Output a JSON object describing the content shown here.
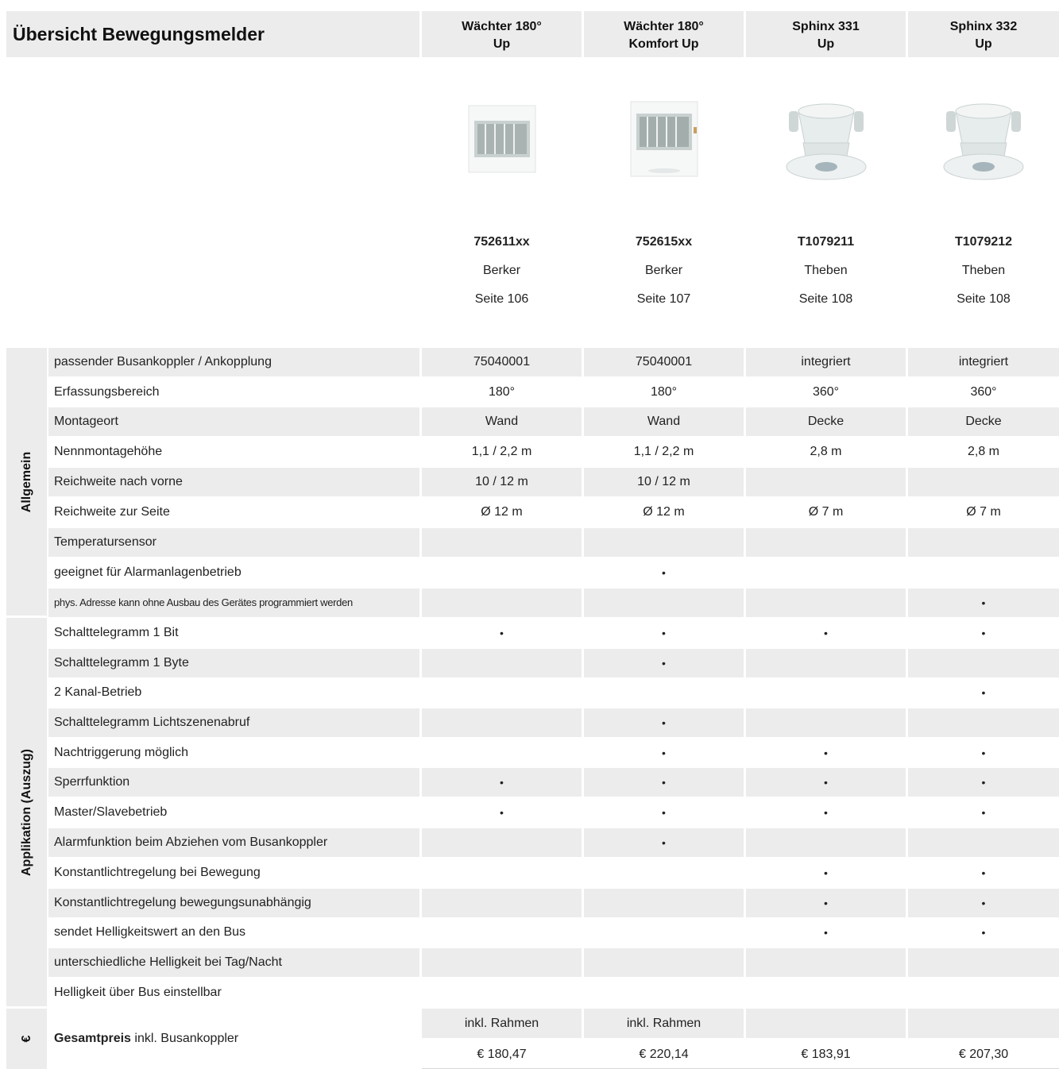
{
  "title": "Übersicht Bewegungsmelder",
  "products": [
    {
      "name1": "Wächter 180°",
      "name2": "Up",
      "number": "752611xx",
      "brand": "Berker",
      "page": "Seite 106",
      "image": "waechter-device-image",
      "extra": "inkl. Rahmen",
      "price": "€ 180,47"
    },
    {
      "name1": "Wächter 180°",
      "name2": "Komfort Up",
      "number": "752615xx",
      "brand": "Berker",
      "page": "Seite 107",
      "image": "waechter-komfort-device-image",
      "extra": "inkl. Rahmen",
      "price": "€ 220,14"
    },
    {
      "name1": "Sphinx 331",
      "name2": "Up",
      "number": "T1079211",
      "brand": "Theben",
      "page": "Seite 108",
      "image": "sphinx-device-image",
      "extra": "",
      "price": "€ 183,91"
    },
    {
      "name1": "Sphinx 332",
      "name2": "Up",
      "number": "T1079212",
      "brand": "Theben",
      "page": "Seite 108",
      "image": "sphinx-device-image",
      "extra": "",
      "price": "€ 207,30"
    }
  ],
  "sections": {
    "allgemein": "Allgemein",
    "applikation": "Applikation (Auszug)",
    "preis": "€"
  },
  "rows": [
    {
      "label": "passender Busankoppler / Ankopplung",
      "values": [
        "75040001",
        "75040001",
        "integriert",
        "integriert"
      ]
    },
    {
      "label": "Erfassungsbereich",
      "values": [
        "180°",
        "180°",
        "360°",
        "360°"
      ]
    },
    {
      "label": "Montageort",
      "values": [
        "Wand",
        "Wand",
        "Decke",
        "Decke"
      ]
    },
    {
      "label": "Nennmontagehöhe",
      "values": [
        "1,1 / 2,2 m",
        "1,1 / 2,2 m",
        "2,8 m",
        "2,8 m"
      ]
    },
    {
      "label": "Reichweite nach vorne",
      "values": [
        "10 / 12 m",
        "10 / 12 m",
        "",
        ""
      ]
    },
    {
      "label": "Reichweite zur Seite",
      "values": [
        "Ø 12 m",
        "Ø 12 m",
        "Ø 7 m",
        "Ø 7 m"
      ]
    },
    {
      "label": "Temperatursensor",
      "values": [
        "",
        "",
        "",
        ""
      ]
    },
    {
      "label": "geeignet für Alarmanlagenbetrieb",
      "values": [
        "",
        "•",
        "",
        ""
      ]
    },
    {
      "label": "phys. Adresse kann ohne Ausbau des Gerätes programmiert werden",
      "values": [
        "",
        "",
        "",
        "•"
      ]
    },
    {
      "label": "Schalttelegramm 1 Bit",
      "values": [
        "•",
        "•",
        "•",
        "•"
      ]
    },
    {
      "label": "Schalttelegramm 1 Byte",
      "values": [
        "",
        "•",
        "",
        ""
      ]
    },
    {
      "label": "2 Kanal-Betrieb",
      "values": [
        "",
        "",
        "",
        "•"
      ]
    },
    {
      "label": "Schalttelegramm Lichtszenenabruf",
      "values": [
        "",
        "•",
        "",
        ""
      ]
    },
    {
      "label": "Nachtriggerung möglich",
      "values": [
        "",
        "•",
        "•",
        "•"
      ]
    },
    {
      "label": "Sperrfunktion",
      "values": [
        "•",
        "•",
        "•",
        "•"
      ]
    },
    {
      "label": "Master/Slavebetrieb",
      "values": [
        "•",
        "•",
        "•",
        "•"
      ]
    },
    {
      "label": "Alarmfunktion beim Abziehen vom Busankoppler",
      "values": [
        "",
        "•",
        "",
        ""
      ]
    },
    {
      "label": "Konstantlichtregelung bei Bewegung",
      "values": [
        "",
        "",
        "•",
        "•"
      ]
    },
    {
      "label": "Konstantlichtregelung bewegungsunabhängig",
      "values": [
        "",
        "",
        "•",
        "•"
      ]
    },
    {
      "label": "sendet Helligkeitswert an den Bus",
      "values": [
        "",
        "",
        "•",
        "•"
      ]
    },
    {
      "label": "unterschiedliche Helligkeit bei Tag/Nacht",
      "values": [
        "",
        "",
        "",
        ""
      ]
    },
    {
      "label": "Helligkeit über Bus einstellbar",
      "values": [
        "",
        "",
        "",
        ""
      ]
    }
  ],
  "price_row": {
    "label_bold": "Gesamtpreis",
    "label_rest": " inkl. Busankoppler"
  }
}
